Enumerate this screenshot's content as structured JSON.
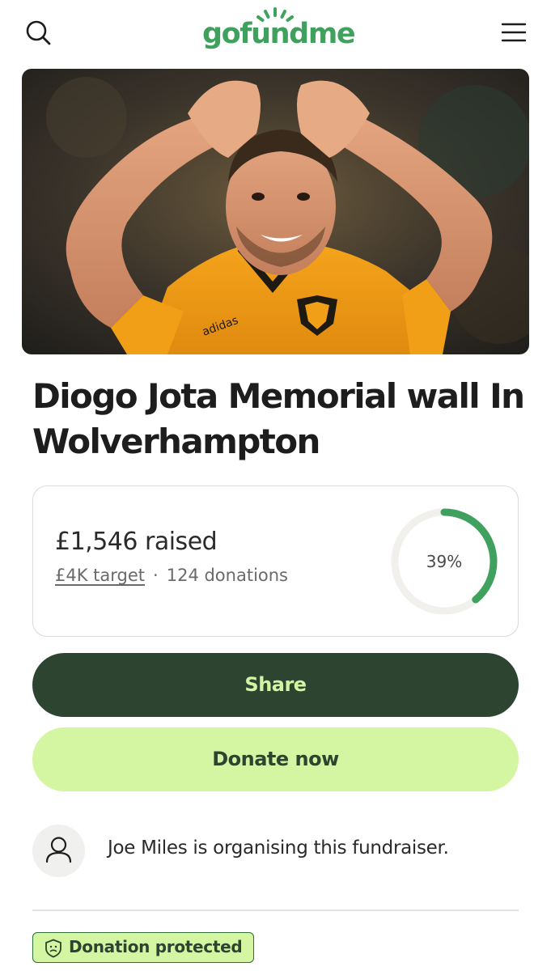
{
  "header": {
    "logo": "gofundme",
    "search_icon": "search-icon",
    "menu_icon": "hamburger-menu-icon"
  },
  "hero": {
    "image": "photo of footballer in orange Wolves kit making heart gesture with hands"
  },
  "fundraiser": {
    "title": "Diogo Jota Memorial wall In Wolverhampton"
  },
  "stats": {
    "raised": "£1,546 raised",
    "target": "£4K target",
    "separator": "·",
    "donations": "124 donations",
    "progress_label": "39%",
    "progress_value": 0.39
  },
  "actions": {
    "share_label": "Share",
    "donate_label": "Donate now"
  },
  "organiser": {
    "text": "Joe Miles is organising this fundraiser."
  },
  "badge": {
    "label": "Donation protected"
  },
  "colors": {
    "brand_green": "#3fa15d",
    "share_bg": "#2c4430",
    "donate_bg": "#d4f6a2",
    "ring_track": "#f1f0ec",
    "ring_fill": "#3fa15d"
  }
}
